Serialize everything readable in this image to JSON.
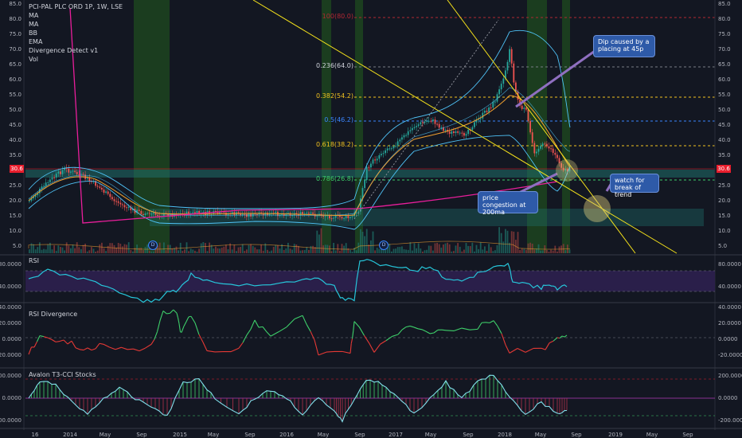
{
  "header": {
    "title": "PCI-PAL PLC ORD 1P, 1W, LSE",
    "indicators": [
      "MA",
      "MA",
      "BB",
      "EMA",
      "Divergence Detect v1",
      "Vol"
    ]
  },
  "price_axis_labels": [
    "85.0",
    "80.0",
    "75.0",
    "70.0",
    "65.0",
    "60.0",
    "55.0",
    "50.0",
    "45.0",
    "40.0",
    "35.0",
    "30.0",
    "25.0",
    "20.0",
    "15.0",
    "10.0",
    "5.0"
  ],
  "current_price": "30.6",
  "fib_levels": [
    {
      "label": "100(80.0)",
      "color": "#b22833"
    },
    {
      "label": "0.236(64.0)",
      "color": "#d1d4dc"
    },
    {
      "label": "0.382(54.2)",
      "color": "#f0c020"
    },
    {
      "label": "0.5(46.2)",
      "color": "#3a86ff"
    },
    {
      "label": "0.618(38.2)",
      "color": "#f0c020"
    },
    {
      "label": "0.786(26.8)",
      "color": "#3ecf6a"
    }
  ],
  "annotations": {
    "dip": "Dip caused by a placing at 45p",
    "trend": "watch for break of trend",
    "congestion": "price congestion at 200ma"
  },
  "divergence_marker": "D",
  "rsi_pane": {
    "title": "RSI",
    "labels": [
      "80.0000",
      "40.0000"
    ]
  },
  "rsi_div_pane": {
    "title": "RSI Divergence",
    "labels": [
      "40.0000",
      "20.0000",
      "0.0000",
      "-20.0000"
    ]
  },
  "cci_pane": {
    "title": "Avalon T3-CCI Stocks",
    "labels": [
      "200.0000",
      "0.0000",
      "-200.0000"
    ]
  },
  "time_axis": [
    "16",
    "2014",
    "May",
    "Sep",
    "2015",
    "May",
    "Sep",
    "2016",
    "May",
    "Sep",
    "2017",
    "May",
    "Sep",
    "2018",
    "May",
    "Sep",
    "2019",
    "May",
    "Sep"
  ],
  "colors": {
    "background": "#131722",
    "up": "#26a69a",
    "down": "#ef5350",
    "trendline": "#f5e21b",
    "ma200": "#e91e9b",
    "bollinger": "#4fc3f7",
    "ema": "#f0a030",
    "rsi": "#26c6da",
    "rsi_band": "#2a1f4a",
    "highlight": "#1b5e20"
  }
}
